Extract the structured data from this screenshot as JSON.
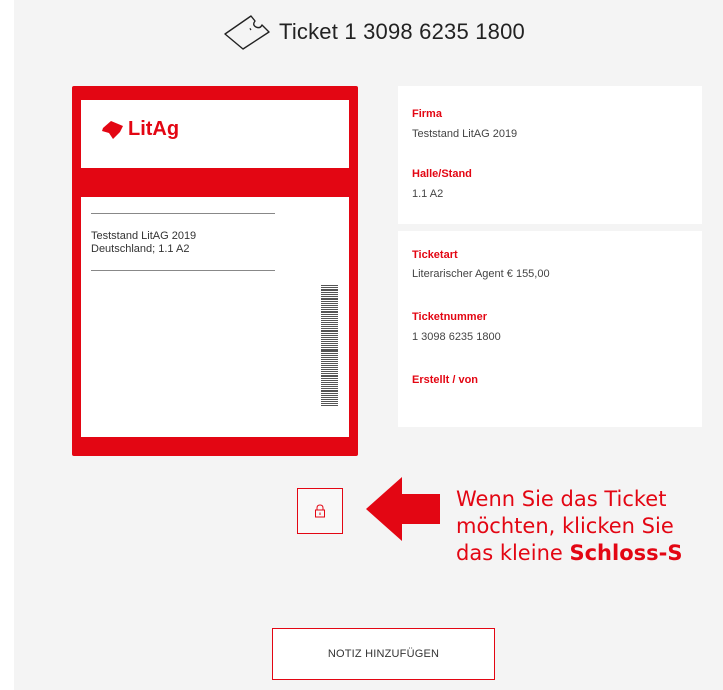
{
  "header": {
    "title": "Ticket 1 3098 6235 1800",
    "icon": "ticket-icon"
  },
  "ticket_card": {
    "logo_text": "LitAg",
    "logo_icon": "litag-logo-icon",
    "line1": "Teststand LitAG 2019",
    "line2": "Deutschland; 1.1 A2"
  },
  "details": {
    "firma_label": "Firma",
    "firma_value": "Teststand LitAG 2019",
    "halle_label": "Halle/Stand",
    "halle_value": "1.1 A2",
    "ticketart_label": "Ticketart",
    "ticketart_value": "Literarischer Agent € 155,00",
    "ticketnummer_label": "Ticketnummer",
    "ticketnummer_value": "1 3098 6235 1800",
    "erstellt_label": "Erstellt / von"
  },
  "lock": {
    "icon": "lock-icon"
  },
  "hint": {
    "line1": "Wenn Sie das Ticket",
    "line2": "möchten, klicken Sie",
    "line3_a": "das kleine ",
    "line3_b": "Schloss-S"
  },
  "actions": {
    "add_note": "NOTIZ HINZUFÜGEN"
  },
  "colors": {
    "accent": "#e30613",
    "background": "#f4f4f4"
  }
}
